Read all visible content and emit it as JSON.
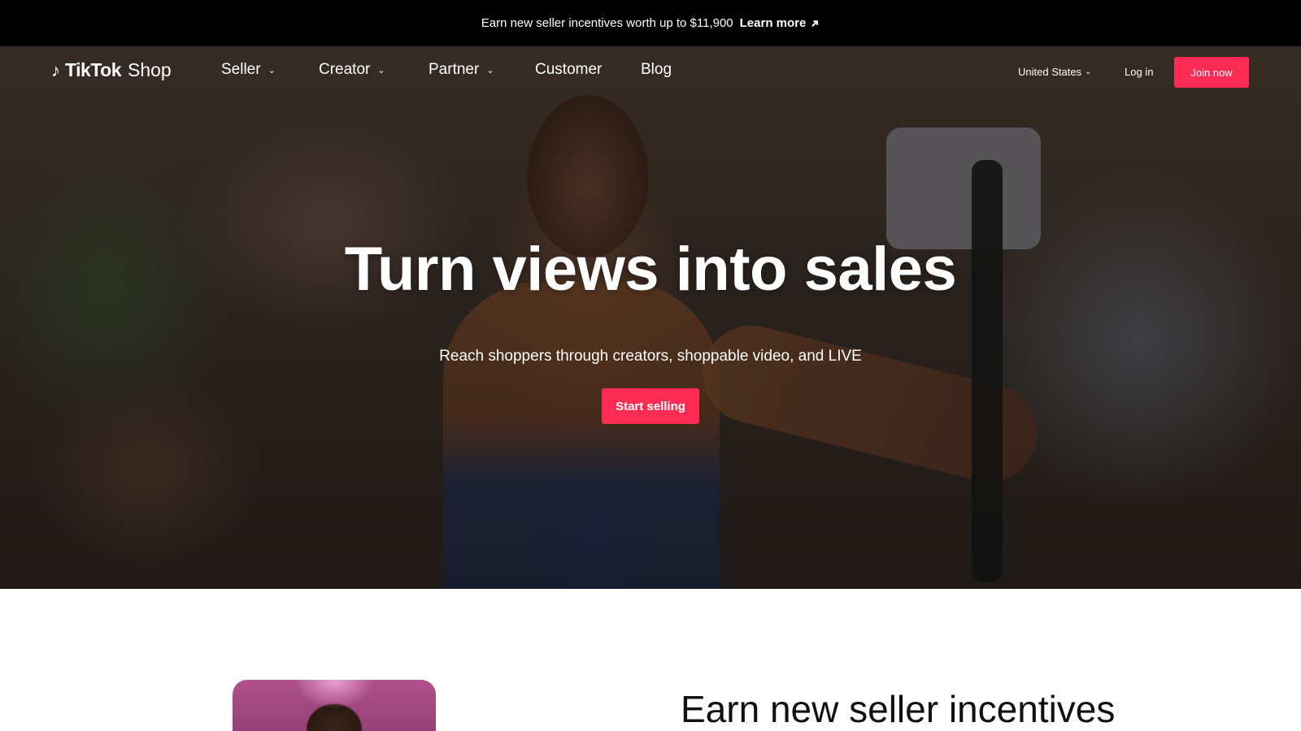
{
  "announcement": {
    "text": "Earn new seller incentives worth up to $11,900",
    "cta_label": "Learn more",
    "cta_icon": "arrow-up-right-icon"
  },
  "nav": {
    "logo": {
      "brand": "TikTok",
      "product": "Shop",
      "icon": "tiktok-note-icon"
    },
    "items": [
      {
        "label": "Seller",
        "has_dropdown": true
      },
      {
        "label": "Creator",
        "has_dropdown": true
      },
      {
        "label": "Partner",
        "has_dropdown": true
      },
      {
        "label": "Customer",
        "has_dropdown": false
      },
      {
        "label": "Blog",
        "has_dropdown": false
      }
    ],
    "region": "United States",
    "login_label": "Log in",
    "join_label": "Join now"
  },
  "hero": {
    "title": "Turn views into sales",
    "subtitle": "Reach shoppers through creators, shoppable video, and LIVE",
    "cta_label": "Start selling"
  },
  "section": {
    "title": "Earn new seller incentives"
  },
  "colors": {
    "accent": "#fe2c55",
    "announcement_bg": "#000000",
    "hero_text": "#ffffff",
    "section_text": "#111111"
  }
}
